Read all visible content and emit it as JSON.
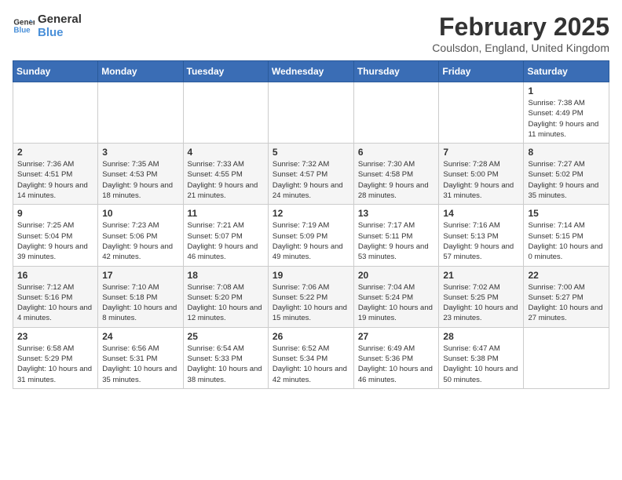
{
  "header": {
    "logo_line1": "General",
    "logo_line2": "Blue",
    "month_year": "February 2025",
    "location": "Coulsdon, England, United Kingdom"
  },
  "weekdays": [
    "Sunday",
    "Monday",
    "Tuesday",
    "Wednesday",
    "Thursday",
    "Friday",
    "Saturday"
  ],
  "weeks": [
    [
      {
        "day": "",
        "info": ""
      },
      {
        "day": "",
        "info": ""
      },
      {
        "day": "",
        "info": ""
      },
      {
        "day": "",
        "info": ""
      },
      {
        "day": "",
        "info": ""
      },
      {
        "day": "",
        "info": ""
      },
      {
        "day": "1",
        "info": "Sunrise: 7:38 AM\nSunset: 4:49 PM\nDaylight: 9 hours and 11 minutes."
      }
    ],
    [
      {
        "day": "2",
        "info": "Sunrise: 7:36 AM\nSunset: 4:51 PM\nDaylight: 9 hours and 14 minutes."
      },
      {
        "day": "3",
        "info": "Sunrise: 7:35 AM\nSunset: 4:53 PM\nDaylight: 9 hours and 18 minutes."
      },
      {
        "day": "4",
        "info": "Sunrise: 7:33 AM\nSunset: 4:55 PM\nDaylight: 9 hours and 21 minutes."
      },
      {
        "day": "5",
        "info": "Sunrise: 7:32 AM\nSunset: 4:57 PM\nDaylight: 9 hours and 24 minutes."
      },
      {
        "day": "6",
        "info": "Sunrise: 7:30 AM\nSunset: 4:58 PM\nDaylight: 9 hours and 28 minutes."
      },
      {
        "day": "7",
        "info": "Sunrise: 7:28 AM\nSunset: 5:00 PM\nDaylight: 9 hours and 31 minutes."
      },
      {
        "day": "8",
        "info": "Sunrise: 7:27 AM\nSunset: 5:02 PM\nDaylight: 9 hours and 35 minutes."
      }
    ],
    [
      {
        "day": "9",
        "info": "Sunrise: 7:25 AM\nSunset: 5:04 PM\nDaylight: 9 hours and 39 minutes."
      },
      {
        "day": "10",
        "info": "Sunrise: 7:23 AM\nSunset: 5:06 PM\nDaylight: 9 hours and 42 minutes."
      },
      {
        "day": "11",
        "info": "Sunrise: 7:21 AM\nSunset: 5:07 PM\nDaylight: 9 hours and 46 minutes."
      },
      {
        "day": "12",
        "info": "Sunrise: 7:19 AM\nSunset: 5:09 PM\nDaylight: 9 hours and 49 minutes."
      },
      {
        "day": "13",
        "info": "Sunrise: 7:17 AM\nSunset: 5:11 PM\nDaylight: 9 hours and 53 minutes."
      },
      {
        "day": "14",
        "info": "Sunrise: 7:16 AM\nSunset: 5:13 PM\nDaylight: 9 hours and 57 minutes."
      },
      {
        "day": "15",
        "info": "Sunrise: 7:14 AM\nSunset: 5:15 PM\nDaylight: 10 hours and 0 minutes."
      }
    ],
    [
      {
        "day": "16",
        "info": "Sunrise: 7:12 AM\nSunset: 5:16 PM\nDaylight: 10 hours and 4 minutes."
      },
      {
        "day": "17",
        "info": "Sunrise: 7:10 AM\nSunset: 5:18 PM\nDaylight: 10 hours and 8 minutes."
      },
      {
        "day": "18",
        "info": "Sunrise: 7:08 AM\nSunset: 5:20 PM\nDaylight: 10 hours and 12 minutes."
      },
      {
        "day": "19",
        "info": "Sunrise: 7:06 AM\nSunset: 5:22 PM\nDaylight: 10 hours and 15 minutes."
      },
      {
        "day": "20",
        "info": "Sunrise: 7:04 AM\nSunset: 5:24 PM\nDaylight: 10 hours and 19 minutes."
      },
      {
        "day": "21",
        "info": "Sunrise: 7:02 AM\nSunset: 5:25 PM\nDaylight: 10 hours and 23 minutes."
      },
      {
        "day": "22",
        "info": "Sunrise: 7:00 AM\nSunset: 5:27 PM\nDaylight: 10 hours and 27 minutes."
      }
    ],
    [
      {
        "day": "23",
        "info": "Sunrise: 6:58 AM\nSunset: 5:29 PM\nDaylight: 10 hours and 31 minutes."
      },
      {
        "day": "24",
        "info": "Sunrise: 6:56 AM\nSunset: 5:31 PM\nDaylight: 10 hours and 35 minutes."
      },
      {
        "day": "25",
        "info": "Sunrise: 6:54 AM\nSunset: 5:33 PM\nDaylight: 10 hours and 38 minutes."
      },
      {
        "day": "26",
        "info": "Sunrise: 6:52 AM\nSunset: 5:34 PM\nDaylight: 10 hours and 42 minutes."
      },
      {
        "day": "27",
        "info": "Sunrise: 6:49 AM\nSunset: 5:36 PM\nDaylight: 10 hours and 46 minutes."
      },
      {
        "day": "28",
        "info": "Sunrise: 6:47 AM\nSunset: 5:38 PM\nDaylight: 10 hours and 50 minutes."
      },
      {
        "day": "",
        "info": ""
      }
    ]
  ]
}
